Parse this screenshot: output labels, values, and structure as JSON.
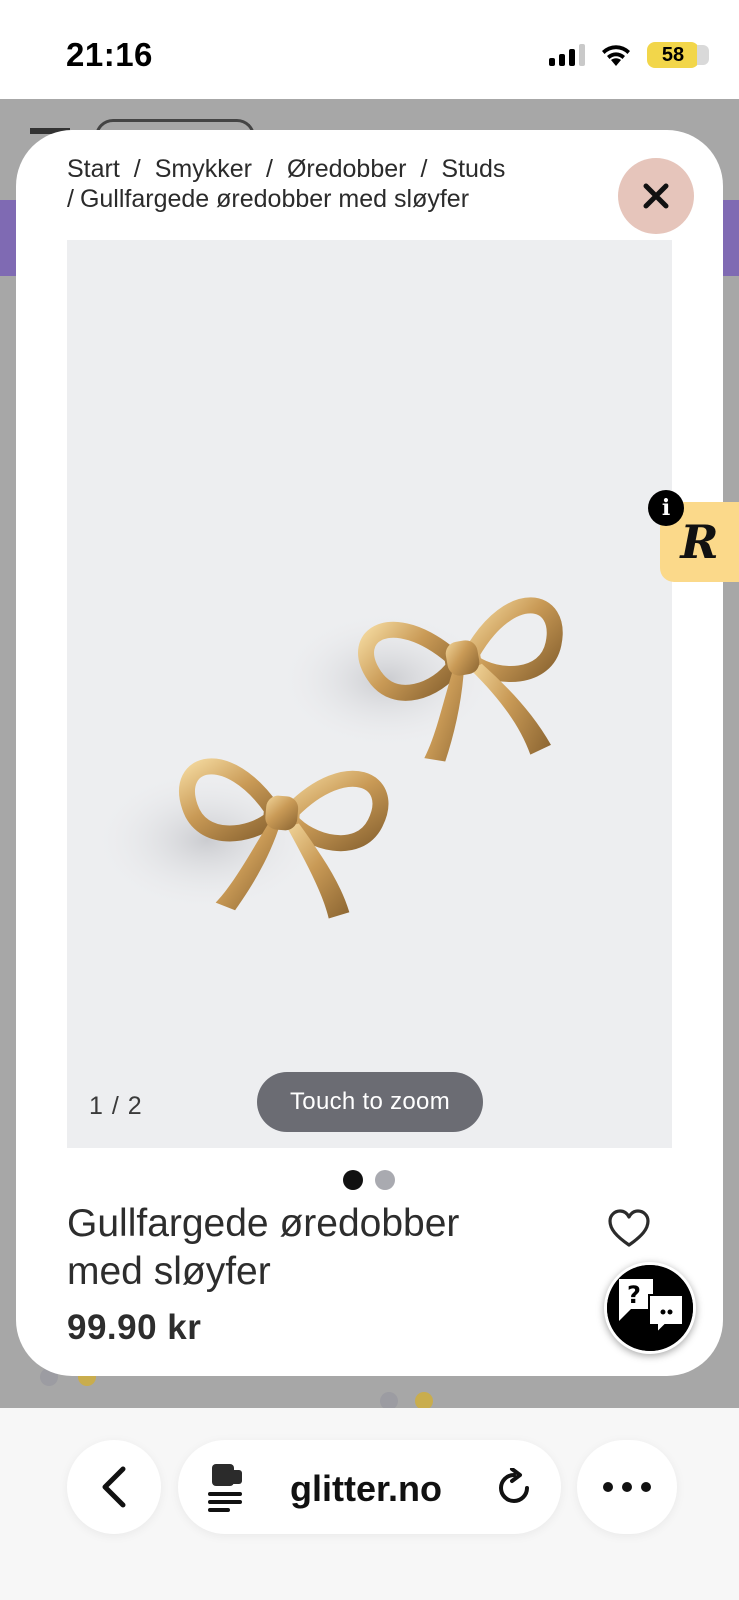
{
  "status_bar": {
    "time": "21:16",
    "battery": "58"
  },
  "breadcrumb": {
    "items": [
      "Start",
      "Smykker",
      "Øredobber",
      "Studs",
      "Gullfargede øredobber med sløyfer"
    ],
    "separator": "/"
  },
  "gallery": {
    "counter": "1 / 2",
    "zoom_hint": "Touch to zoom",
    "total_images": 2,
    "active_index": 1
  },
  "product": {
    "title": "Gullfargede øredobber med sløyfer",
    "price": "99.90 kr"
  },
  "reviews_widget": {
    "letter": "R",
    "info": "i"
  },
  "help_widget": {
    "glyph": "?"
  },
  "browser": {
    "url": "glitter.no"
  },
  "colors": {
    "close_button_bg": "#e6c5bb",
    "zoom_pill_bg": "#6b6c73",
    "reviews_tab_bg": "#fbd98a",
    "battery_bg": "#f2d64a",
    "dot_active": "#111111",
    "dot_inactive": "#a9aab0",
    "backdrop": "#a7a7a7",
    "bg_banner": "#7f6ab3"
  },
  "icons": {
    "close": "close-icon",
    "wishlist": "heart-icon",
    "back": "chevron-left-icon",
    "page": "page-menu-icon",
    "reload": "reload-icon",
    "more": "more-icon",
    "help": "help-chat-icon"
  }
}
